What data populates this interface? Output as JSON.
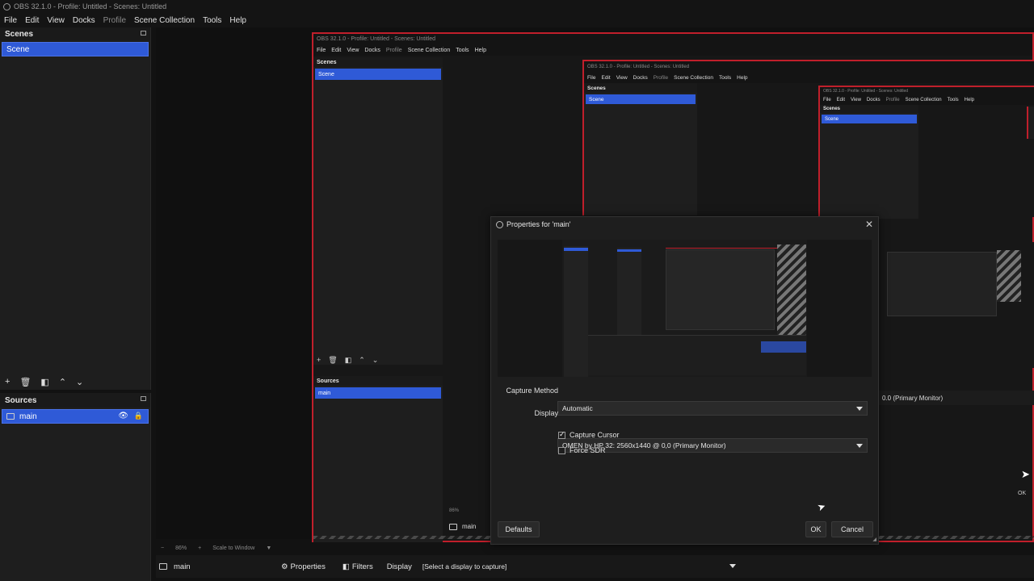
{
  "window": {
    "title": "OBS 32.1.0 - Profile: Untitled - Scenes: Untitled"
  },
  "menu": {
    "items": [
      "File",
      "Edit",
      "View",
      "Docks",
      "Profile",
      "Scene Collection",
      "Tools",
      "Help"
    ]
  },
  "scenes_dock": {
    "title": "Scenes",
    "items": [
      "Scene"
    ]
  },
  "sources_dock": {
    "title": "Sources",
    "items": [
      "main"
    ]
  },
  "nested": {
    "title": "OBS 32.1.0 - Profile: Untitled - Scenes: Untitled",
    "scenes_title": "Scenes",
    "scene_item": "Scene",
    "sources_title": "Sources",
    "source_item": "main",
    "zoom": "86%",
    "status_source": "main",
    "display_snippet": "0.0 (Primary Monitor)",
    "ok_label": "OK"
  },
  "dialog": {
    "title": "Properties for 'main'",
    "capture_method_label": "Capture Method",
    "capture_method_value": "Automatic",
    "display_label": "Display",
    "display_value": "OMEN by HP 32: 2560x1440 @ 0,0 (Primary Monitor)",
    "capture_cursor_label": "Capture Cursor",
    "capture_cursor_checked": true,
    "force_sdr_label": "Force SDR",
    "force_sdr_checked": false,
    "defaults_label": "Defaults",
    "ok_label": "OK",
    "cancel_label": "Cancel"
  },
  "zoom_bar": {
    "zoom": "86%",
    "scale": "Scale to Window"
  },
  "source_toolbar": {
    "source_name": "main",
    "properties_label": "Properties",
    "filters_label": "Filters",
    "display_label": "Display",
    "display_value": "[Select a display to capture]"
  },
  "colors": {
    "accent": "#2f5ad7",
    "record_border": "#c01f2b",
    "background": "#121212"
  }
}
